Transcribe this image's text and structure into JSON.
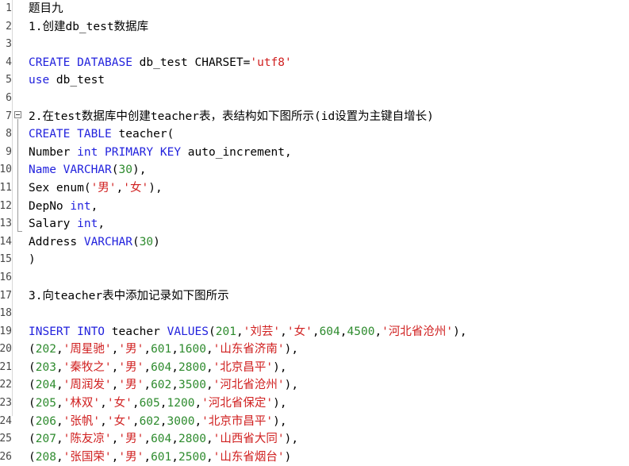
{
  "editor": {
    "name": "sql-code-editor",
    "background_color": "#ffffff",
    "gutter_separator_color": "#d8d8d8",
    "fold_marker": "minus",
    "fold_start_line": 8,
    "fold_end_line": 15,
    "syntax_colors": {
      "keyword": "#2222dd",
      "number": "#2e8b2e",
      "string": "#d02020",
      "plain": "#000000",
      "line_number": "#484848"
    }
  },
  "line_numbers": [
    "1",
    "2",
    "3",
    "4",
    "5",
    "6",
    "7",
    "8",
    "9",
    "10",
    "11",
    "12",
    "13",
    "14",
    "15",
    "16",
    "17",
    "18",
    "19",
    "20",
    "21",
    "22",
    "23",
    "24",
    "25",
    "26"
  ],
  "lines": [
    {
      "n": "1",
      "tokens": [
        {
          "t": "plain",
          "v": "题目九"
        }
      ]
    },
    {
      "n": "2",
      "tokens": [
        {
          "t": "plain",
          "v": "1.创建db_test数据库"
        }
      ]
    },
    {
      "n": "3",
      "tokens": [
        {
          "t": "plain",
          "v": ""
        }
      ]
    },
    {
      "n": "4",
      "tokens": [
        {
          "t": "kw",
          "v": "CREATE DATABASE"
        },
        {
          "t": "plain",
          "v": " db_test CHARSET="
        },
        {
          "t": "str",
          "v": "'utf8'"
        }
      ]
    },
    {
      "n": "5",
      "tokens": [
        {
          "t": "kw",
          "v": "use"
        },
        {
          "t": "plain",
          "v": " db_test"
        }
      ]
    },
    {
      "n": "6",
      "tokens": [
        {
          "t": "plain",
          "v": ""
        }
      ]
    },
    {
      "n": "7",
      "tokens": [
        {
          "t": "plain",
          "v": "2.在test数据库中创建teacher表，表结构如下图所示(id设置为主键自增长)"
        }
      ]
    },
    {
      "n": "8",
      "tokens": [
        {
          "t": "kw",
          "v": "CREATE TABLE"
        },
        {
          "t": "plain",
          "v": " teacher("
        }
      ]
    },
    {
      "n": "9",
      "tokens": [
        {
          "t": "plain",
          "v": "Number "
        },
        {
          "t": "kw",
          "v": "int PRIMARY KEY"
        },
        {
          "t": "plain",
          "v": " auto_increment,"
        }
      ]
    },
    {
      "n": "10",
      "tokens": [
        {
          "t": "kw",
          "v": "Name VARCHAR"
        },
        {
          "t": "plain",
          "v": "("
        },
        {
          "t": "num",
          "v": "30"
        },
        {
          "t": "plain",
          "v": "),"
        }
      ]
    },
    {
      "n": "11",
      "tokens": [
        {
          "t": "plain",
          "v": "Sex enum("
        },
        {
          "t": "str",
          "v": "'男'"
        },
        {
          "t": "plain",
          "v": ","
        },
        {
          "t": "str",
          "v": "'女'"
        },
        {
          "t": "plain",
          "v": "),"
        }
      ]
    },
    {
      "n": "12",
      "tokens": [
        {
          "t": "plain",
          "v": "DepNo "
        },
        {
          "t": "kw",
          "v": "int"
        },
        {
          "t": "plain",
          "v": ","
        }
      ]
    },
    {
      "n": "13",
      "tokens": [
        {
          "t": "plain",
          "v": "Salary "
        },
        {
          "t": "kw",
          "v": "int"
        },
        {
          "t": "plain",
          "v": ","
        }
      ]
    },
    {
      "n": "14",
      "tokens": [
        {
          "t": "plain",
          "v": "Address "
        },
        {
          "t": "kw",
          "v": "VARCHAR"
        },
        {
          "t": "plain",
          "v": "("
        },
        {
          "t": "num",
          "v": "30"
        },
        {
          "t": "plain",
          "v": ")"
        }
      ]
    },
    {
      "n": "15",
      "tokens": [
        {
          "t": "plain",
          "v": ")"
        }
      ]
    },
    {
      "n": "16",
      "tokens": [
        {
          "t": "plain",
          "v": ""
        }
      ]
    },
    {
      "n": "17",
      "tokens": [
        {
          "t": "plain",
          "v": "3.向teacher表中添加记录如下图所示"
        }
      ]
    },
    {
      "n": "18",
      "tokens": [
        {
          "t": "plain",
          "v": ""
        }
      ]
    },
    {
      "n": "19",
      "tokens": [
        {
          "t": "kw",
          "v": "INSERT INTO"
        },
        {
          "t": "plain",
          "v": " teacher "
        },
        {
          "t": "kw",
          "v": "VALUES"
        },
        {
          "t": "plain",
          "v": "("
        },
        {
          "t": "num",
          "v": "201"
        },
        {
          "t": "plain",
          "v": ","
        },
        {
          "t": "str",
          "v": "'刘芸'"
        },
        {
          "t": "plain",
          "v": ","
        },
        {
          "t": "str",
          "v": "'女'"
        },
        {
          "t": "plain",
          "v": ","
        },
        {
          "t": "num",
          "v": "604"
        },
        {
          "t": "plain",
          "v": ","
        },
        {
          "t": "num",
          "v": "4500"
        },
        {
          "t": "plain",
          "v": ","
        },
        {
          "t": "str",
          "v": "'河北省沧州'"
        },
        {
          "t": "plain",
          "v": "),"
        }
      ]
    },
    {
      "n": "20",
      "tokens": [
        {
          "t": "plain",
          "v": "("
        },
        {
          "t": "num",
          "v": "202"
        },
        {
          "t": "plain",
          "v": ","
        },
        {
          "t": "str",
          "v": "'周星驰'"
        },
        {
          "t": "plain",
          "v": ","
        },
        {
          "t": "str",
          "v": "'男'"
        },
        {
          "t": "plain",
          "v": ","
        },
        {
          "t": "num",
          "v": "601"
        },
        {
          "t": "plain",
          "v": ","
        },
        {
          "t": "num",
          "v": "1600"
        },
        {
          "t": "plain",
          "v": ","
        },
        {
          "t": "str",
          "v": "'山东省济南'"
        },
        {
          "t": "plain",
          "v": "),"
        }
      ]
    },
    {
      "n": "21",
      "tokens": [
        {
          "t": "plain",
          "v": "("
        },
        {
          "t": "num",
          "v": "203"
        },
        {
          "t": "plain",
          "v": ","
        },
        {
          "t": "str",
          "v": "'秦牧之'"
        },
        {
          "t": "plain",
          "v": ","
        },
        {
          "t": "str",
          "v": "'男'"
        },
        {
          "t": "plain",
          "v": ","
        },
        {
          "t": "num",
          "v": "604"
        },
        {
          "t": "plain",
          "v": ","
        },
        {
          "t": "num",
          "v": "2800"
        },
        {
          "t": "plain",
          "v": ","
        },
        {
          "t": "str",
          "v": "'北京昌平'"
        },
        {
          "t": "plain",
          "v": "),"
        }
      ]
    },
    {
      "n": "22",
      "tokens": [
        {
          "t": "plain",
          "v": "("
        },
        {
          "t": "num",
          "v": "204"
        },
        {
          "t": "plain",
          "v": ","
        },
        {
          "t": "str",
          "v": "'周润发'"
        },
        {
          "t": "plain",
          "v": ","
        },
        {
          "t": "str",
          "v": "'男'"
        },
        {
          "t": "plain",
          "v": ","
        },
        {
          "t": "num",
          "v": "602"
        },
        {
          "t": "plain",
          "v": ","
        },
        {
          "t": "num",
          "v": "3500"
        },
        {
          "t": "plain",
          "v": ","
        },
        {
          "t": "str",
          "v": "'河北省沧州'"
        },
        {
          "t": "plain",
          "v": "),"
        }
      ]
    },
    {
      "n": "23",
      "tokens": [
        {
          "t": "plain",
          "v": "("
        },
        {
          "t": "num",
          "v": "205"
        },
        {
          "t": "plain",
          "v": ","
        },
        {
          "t": "str",
          "v": "'林双'"
        },
        {
          "t": "plain",
          "v": ","
        },
        {
          "t": "str",
          "v": "'女'"
        },
        {
          "t": "plain",
          "v": ","
        },
        {
          "t": "num",
          "v": "605"
        },
        {
          "t": "plain",
          "v": ","
        },
        {
          "t": "num",
          "v": "1200"
        },
        {
          "t": "plain",
          "v": ","
        },
        {
          "t": "str",
          "v": "'河北省保定'"
        },
        {
          "t": "plain",
          "v": "),"
        }
      ]
    },
    {
      "n": "24",
      "tokens": [
        {
          "t": "plain",
          "v": "("
        },
        {
          "t": "num",
          "v": "206"
        },
        {
          "t": "plain",
          "v": ","
        },
        {
          "t": "str",
          "v": "'张帆'"
        },
        {
          "t": "plain",
          "v": ","
        },
        {
          "t": "str",
          "v": "'女'"
        },
        {
          "t": "plain",
          "v": ","
        },
        {
          "t": "num",
          "v": "602"
        },
        {
          "t": "plain",
          "v": ","
        },
        {
          "t": "num",
          "v": "3000"
        },
        {
          "t": "plain",
          "v": ","
        },
        {
          "t": "str",
          "v": "'北京市昌平'"
        },
        {
          "t": "plain",
          "v": "),"
        }
      ]
    },
    {
      "n": "25",
      "tokens": [
        {
          "t": "plain",
          "v": "("
        },
        {
          "t": "num",
          "v": "207"
        },
        {
          "t": "plain",
          "v": ","
        },
        {
          "t": "str",
          "v": "'陈友凉'"
        },
        {
          "t": "plain",
          "v": ","
        },
        {
          "t": "str",
          "v": "'男'"
        },
        {
          "t": "plain",
          "v": ","
        },
        {
          "t": "num",
          "v": "604"
        },
        {
          "t": "plain",
          "v": ","
        },
        {
          "t": "num",
          "v": "2800"
        },
        {
          "t": "plain",
          "v": ","
        },
        {
          "t": "str",
          "v": "'山西省大同'"
        },
        {
          "t": "plain",
          "v": "),"
        }
      ]
    },
    {
      "n": "26",
      "tokens": [
        {
          "t": "plain",
          "v": "("
        },
        {
          "t": "num",
          "v": "208"
        },
        {
          "t": "plain",
          "v": ","
        },
        {
          "t": "str",
          "v": "'张国荣'"
        },
        {
          "t": "plain",
          "v": ","
        },
        {
          "t": "str",
          "v": "'男'"
        },
        {
          "t": "plain",
          "v": ","
        },
        {
          "t": "num",
          "v": "601"
        },
        {
          "t": "plain",
          "v": ","
        },
        {
          "t": "num",
          "v": "2500"
        },
        {
          "t": "plain",
          "v": ","
        },
        {
          "t": "str",
          "v": "'山东省烟台'"
        },
        {
          "t": "plain",
          "v": ")"
        }
      ]
    }
  ]
}
